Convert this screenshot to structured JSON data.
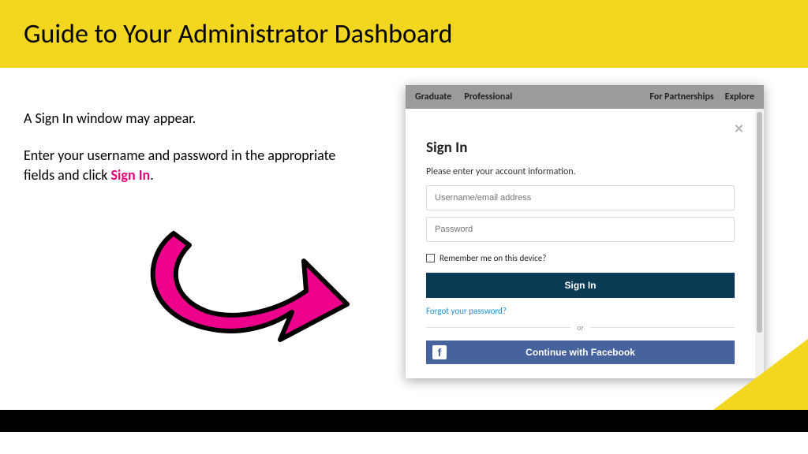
{
  "title": "Guide to Your Administrator Dashboard",
  "instructions": {
    "line1": "A Sign In window may appear.",
    "line2_pre": "Enter your username and password in the appropriate fields and click ",
    "line2_highlight": "Sign In",
    "line2_post": "."
  },
  "nav": {
    "left": [
      "Graduate",
      "Professional"
    ],
    "right": [
      "For Partnerships",
      "Explore"
    ]
  },
  "modal": {
    "heading": "Sign In",
    "subhead": "Please enter your account information.",
    "username_placeholder": "Username/email address",
    "password_placeholder": "Password",
    "remember_label": "Remember me on this device?",
    "signin_button": "Sign In",
    "forgot_link": "Forgot your password?",
    "or_text": "or",
    "facebook_button": "Continue with Facebook"
  }
}
